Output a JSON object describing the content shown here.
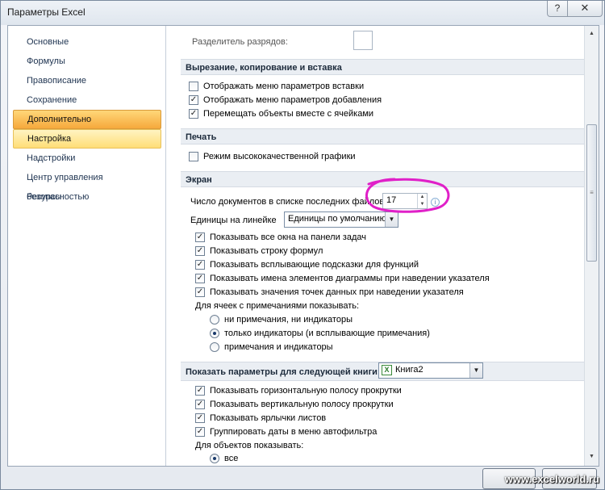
{
  "window": {
    "title": "Параметры Excel",
    "help_label": "?",
    "close_label": "✕"
  },
  "sidebar": {
    "items": [
      {
        "label": "Основные"
      },
      {
        "label": "Формулы"
      },
      {
        "label": "Правописание"
      },
      {
        "label": "Сохранение"
      },
      {
        "label": "Дополнительно"
      },
      {
        "label": "Настройка"
      },
      {
        "label": "Надстройки"
      },
      {
        "label": "Центр управления безопасностью"
      },
      {
        "label": "Ресурсы"
      }
    ],
    "active_index": 4,
    "hover_index": 5
  },
  "options": {
    "separator_label": "Разделитель разрядов:",
    "cut_copy_paste": {
      "title": "Вырезание, копирование и вставка",
      "items": [
        {
          "label": "Отображать меню параметров вставки",
          "checked": false
        },
        {
          "label": "Отображать меню параметров добавления",
          "checked": true
        },
        {
          "label": "Перемещать объекты вместе с ячейками",
          "checked": true
        }
      ]
    },
    "print": {
      "title": "Печать",
      "items": [
        {
          "label": "Режим высококачественной графики",
          "checked": false
        }
      ]
    },
    "screen": {
      "title": "Экран",
      "recent_files_label": "Число документов в списке последних файлов:",
      "recent_files_value": "17",
      "ruler_units_label": "Единицы на линейке",
      "ruler_units_value": "Единицы по умолчанию",
      "items": [
        {
          "label": "Показывать все окна на панели задач",
          "checked": true
        },
        {
          "label": "Показывать строку формул",
          "checked": true
        },
        {
          "label": "Показывать всплывающие подсказки для функций",
          "checked": true
        },
        {
          "label": "Показывать имена элементов диаграммы при наведении указателя",
          "checked": true
        },
        {
          "label": "Показывать значения точек данных при наведении указателя",
          "checked": true
        }
      ],
      "comments_label": "Для ячеек с примечаниями показывать:",
      "comments_options": [
        {
          "label": "ни примечания, ни индикаторы",
          "selected": false
        },
        {
          "label": "только индикаторы (и всплывающие примечания)",
          "selected": true
        },
        {
          "label": "примечания и индикаторы",
          "selected": false
        }
      ]
    },
    "workbook": {
      "title": "Показать параметры для следующей книги:",
      "book_value": "Книга2",
      "items": [
        {
          "label": "Показывать горизонтальную полосу прокрутки",
          "checked": true
        },
        {
          "label": "Показывать вертикальную полосу прокрутки",
          "checked": true
        },
        {
          "label": "Показывать ярлычки листов",
          "checked": true
        },
        {
          "label": "Группировать даты в меню автофильтра",
          "checked": true
        }
      ],
      "objects_label": "Для объектов показывать:",
      "objects_options": [
        {
          "label": "все",
          "selected": true
        }
      ]
    }
  },
  "watermark": "www.excelworld.ru",
  "colors": {
    "active_nav": "#f6a93c",
    "hover_nav": "#ffdd77",
    "annotation": "#e020c8"
  },
  "icons": {
    "check": "✓",
    "info": "i",
    "dropdown": "▼",
    "spin_up": "▲",
    "spin_down": "▼",
    "scroll_grip": "≡",
    "excel_file": "X"
  }
}
